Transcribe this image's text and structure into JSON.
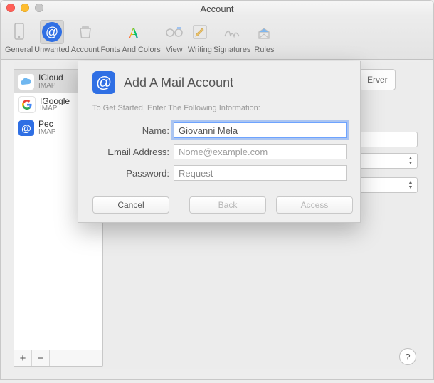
{
  "window": {
    "title": "Account"
  },
  "toolbar": {
    "items": [
      {
        "id": "general",
        "label": "General"
      },
      {
        "id": "unwanted",
        "label": "Unwanted",
        "selected": true
      },
      {
        "id": "account",
        "label": "Account"
      },
      {
        "id": "fonts",
        "label": "Fonts And Colors"
      },
      {
        "id": "view",
        "label": "View"
      },
      {
        "id": "writing",
        "label": "Writing"
      },
      {
        "id": "signatures",
        "label": "Signatures"
      },
      {
        "id": "rules",
        "label": "Rules"
      }
    ]
  },
  "sidebar": {
    "accounts": [
      {
        "name": "ICloud",
        "proto": "IMAP",
        "icon": "cloud",
        "selected": true
      },
      {
        "name": "IGoogle",
        "proto": "IMAP",
        "icon": "google"
      },
      {
        "name": "Pec",
        "proto": "IMAP",
        "icon": "at"
      }
    ],
    "add_label": "+",
    "remove_label": "−"
  },
  "right_panel": {
    "tab_label": "Erver"
  },
  "sheet": {
    "title": "Add A Mail Account",
    "subtitle": "To Get Started, Enter The Following Information:",
    "fields": {
      "name": {
        "label": "Name:",
        "value": "Giovanni Mela"
      },
      "email": {
        "label": "Email Address:",
        "placeholder": "Nome@example.com"
      },
      "password": {
        "label": "Password:",
        "value": "Request"
      }
    },
    "buttons": {
      "cancel": "Cancel",
      "back": "Back",
      "access": "Access"
    }
  },
  "help_label": "?"
}
